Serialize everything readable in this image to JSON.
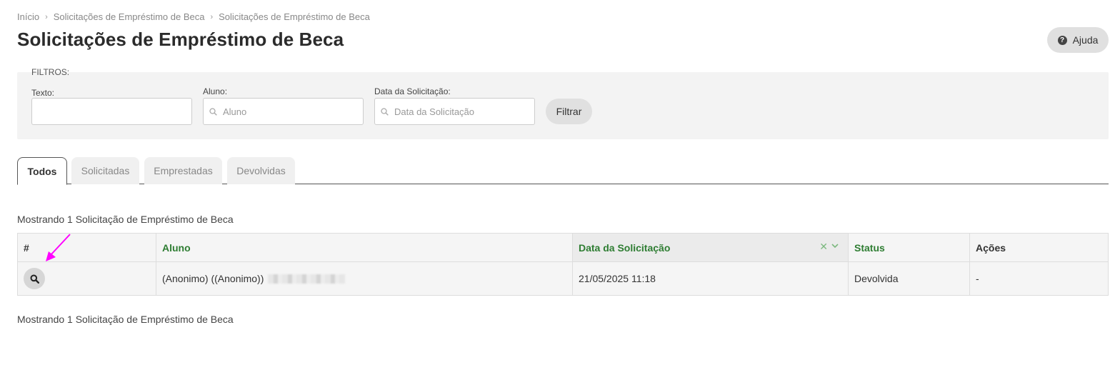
{
  "breadcrumb": [
    "Início",
    "Solicitações de Empréstimo de Beca",
    "Solicitações de Empréstimo de Beca"
  ],
  "page_title": "Solicitações de Empréstimo de Beca",
  "help_label": "Ajuda",
  "filters": {
    "legend": "FILTROS:",
    "texto_label": "Texto:",
    "texto_value": "",
    "aluno_label": "Aluno:",
    "aluno_placeholder": "Aluno",
    "data_label": "Data da Solicitação:",
    "data_placeholder": "Data da Solicitação",
    "button_label": "Filtrar"
  },
  "tabs": [
    "Todos",
    "Solicitadas",
    "Emprestadas",
    "Devolvidas"
  ],
  "active_tab": "Todos",
  "count_text": "Mostrando 1 Solicitação de Empréstimo de Beca",
  "table": {
    "headers": [
      "#",
      "Aluno",
      "Data da Solicitação",
      "Status",
      "Ações"
    ],
    "rows": [
      {
        "aluno": "(Anonimo) ((Anonimo))",
        "data": "21/05/2025 11:18",
        "status": "Devolvida",
        "acoes": "-"
      }
    ]
  },
  "colors": {
    "accent_green": "#2e7d32",
    "arrow": "#ff00ff"
  },
  "icons": {
    "help": "question-circle-icon",
    "search": "magnifier-icon",
    "view": "search-icon",
    "sort": "close-and-chevron-icons",
    "annotation": "arrow-icon"
  }
}
